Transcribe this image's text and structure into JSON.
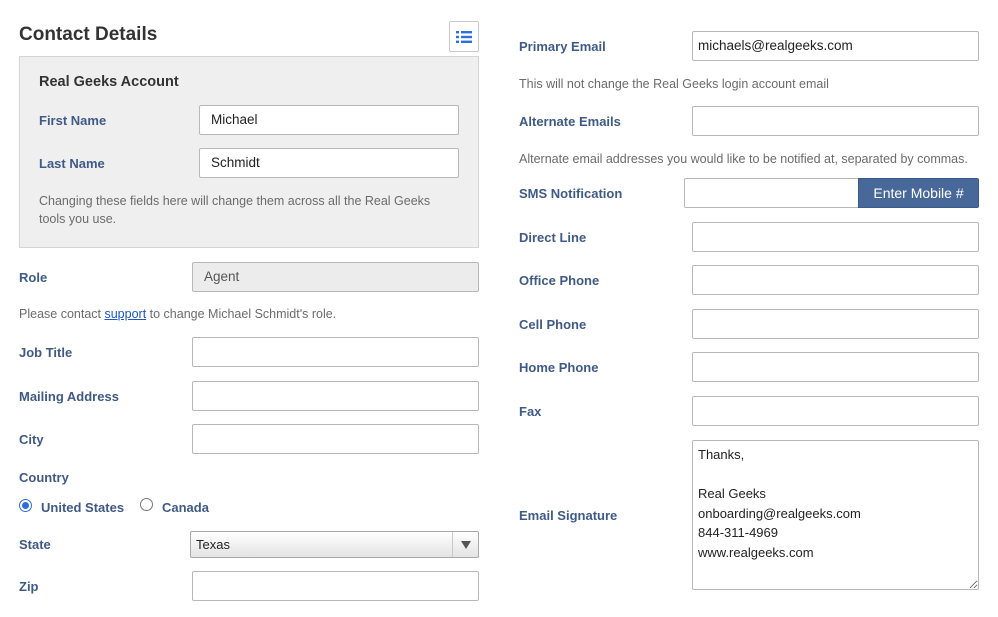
{
  "page": {
    "title": "Contact Details",
    "list_icon": "list-icon"
  },
  "account_panel": {
    "title": "Real Geeks Account",
    "first_name_label": "First Name",
    "first_name_value": "Michael",
    "last_name_label": "Last Name",
    "last_name_value": "Schmidt",
    "help": "Changing these fields here will change them across all the Real Geeks tools you use."
  },
  "left": {
    "role_label": "Role",
    "role_value": "Agent",
    "role_help_prefix": "Please contact ",
    "role_help_link": "support",
    "role_help_suffix": " to change Michael Schmidt's role.",
    "job_title_label": "Job Title",
    "job_title_value": "",
    "mailing_address_label": "Mailing Address",
    "mailing_address_value": "",
    "city_label": "City",
    "city_value": "",
    "country_label": "Country",
    "country_options": [
      "United States",
      "Canada"
    ],
    "country_selected": "United States",
    "state_label": "State",
    "state_value": "Texas",
    "zip_label": "Zip",
    "zip_value": ""
  },
  "right": {
    "primary_email_label": "Primary Email",
    "primary_email_value": "michaels@realgeeks.com",
    "primary_email_help": "This will not change the Real Geeks login account email",
    "alternate_emails_label": "Alternate Emails",
    "alternate_emails_value": "",
    "alternate_emails_help": "Alternate email addresses you would like to be notified at, separated by commas.",
    "sms_label": "SMS Notification",
    "sms_value": "",
    "sms_button": "Enter Mobile #",
    "direct_line_label": "Direct Line",
    "office_phone_label": "Office Phone",
    "cell_phone_label": "Cell Phone",
    "home_phone_label": "Home Phone",
    "fax_label": "Fax",
    "email_signature_label": "Email Signature",
    "email_signature_value": "Thanks,\n\nReal Geeks\nonboarding@realgeeks.com\n844-311-4969\nwww.realgeeks.com"
  },
  "colors": {
    "label": "#3f5a86",
    "button": "#48689a",
    "panel_bg": "#efefef"
  }
}
